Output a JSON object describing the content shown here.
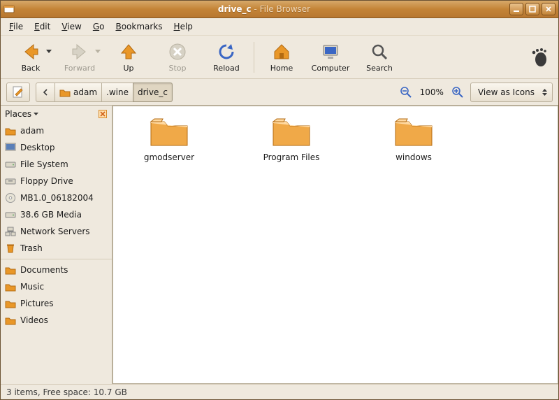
{
  "window": {
    "folder": "drive_c",
    "app": "File Browser"
  },
  "menus": [
    "File",
    "Edit",
    "View",
    "Go",
    "Bookmarks",
    "Help"
  ],
  "toolbar": {
    "back": "Back",
    "forward": "Forward",
    "up": "Up",
    "stop": "Stop",
    "reload": "Reload",
    "home": "Home",
    "computer": "Computer",
    "search": "Search"
  },
  "path": {
    "root": "adam",
    "seg1": ".wine",
    "seg2": "drive_c"
  },
  "zoom": {
    "pct": "100%"
  },
  "viewmode": {
    "label": "View as Icons"
  },
  "sidebar": {
    "header": "Places",
    "items": [
      {
        "label": "adam",
        "icon": "home"
      },
      {
        "label": "Desktop",
        "icon": "desktop"
      },
      {
        "label": "File System",
        "icon": "drive"
      },
      {
        "label": "Floppy Drive",
        "icon": "drive"
      },
      {
        "label": "MB1.0_06182004",
        "icon": "disc"
      },
      {
        "label": "38.6 GB Media",
        "icon": "drive"
      },
      {
        "label": "Network Servers",
        "icon": "network"
      },
      {
        "label": "Trash",
        "icon": "trash"
      }
    ],
    "bookmarks": [
      {
        "label": "Documents"
      },
      {
        "label": "Music"
      },
      {
        "label": "Pictures"
      },
      {
        "label": "Videos"
      }
    ]
  },
  "files": [
    {
      "label": "gmodserver"
    },
    {
      "label": "Program Files"
    },
    {
      "label": "windows"
    }
  ],
  "status": "3 items, Free space: 10.7 GB"
}
